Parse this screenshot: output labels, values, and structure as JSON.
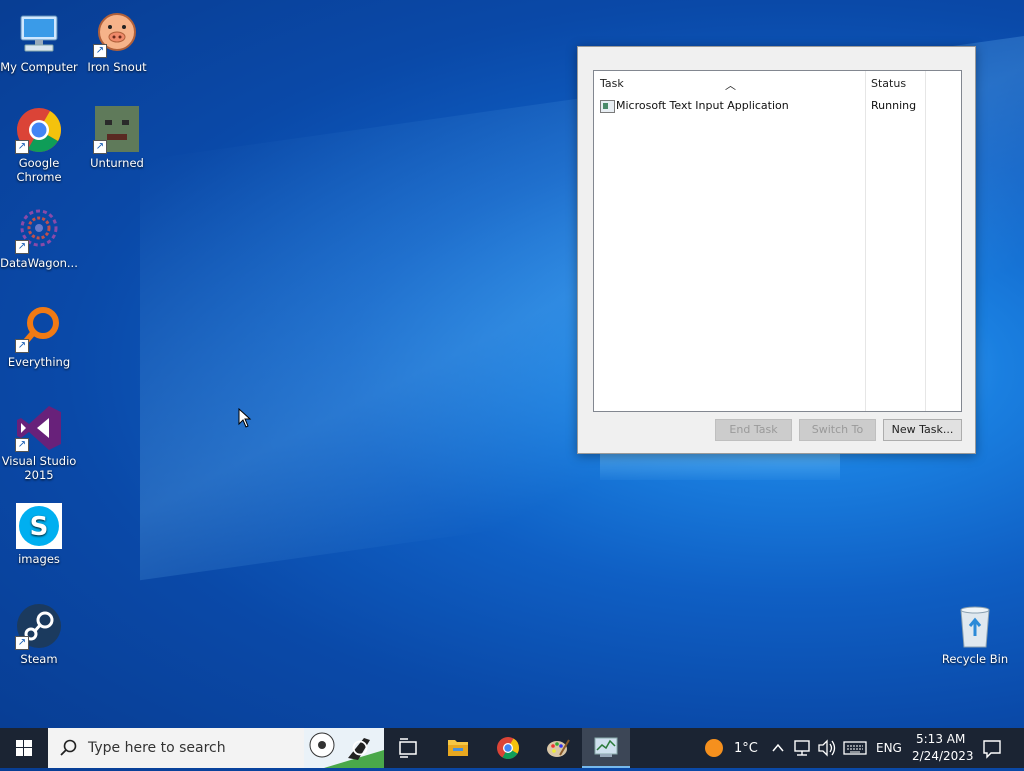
{
  "desktop": {
    "icons": [
      {
        "label": "My Computer"
      },
      {
        "label": "Iron Snout"
      },
      {
        "label": "Google Chrome"
      },
      {
        "label": "Unturned"
      },
      {
        "label": "DataWagon..."
      },
      {
        "label": "Everything"
      },
      {
        "label": "Visual Studio 2015"
      },
      {
        "label": "images"
      },
      {
        "label": "Steam"
      },
      {
        "label": "Recycle Bin"
      }
    ]
  },
  "task_dialog": {
    "columns": {
      "task": "Task",
      "status": "Status"
    },
    "rows": [
      {
        "task": "Microsoft Text Input Application",
        "status": "Running"
      }
    ],
    "buttons": {
      "end_task": "End Task",
      "switch_to": "Switch To",
      "new_task": "New Task..."
    }
  },
  "taskbar": {
    "search_placeholder": "Type here to search",
    "weather": "1°C",
    "language": "ENG",
    "time": "5:13 AM",
    "date": "2/24/2023"
  }
}
